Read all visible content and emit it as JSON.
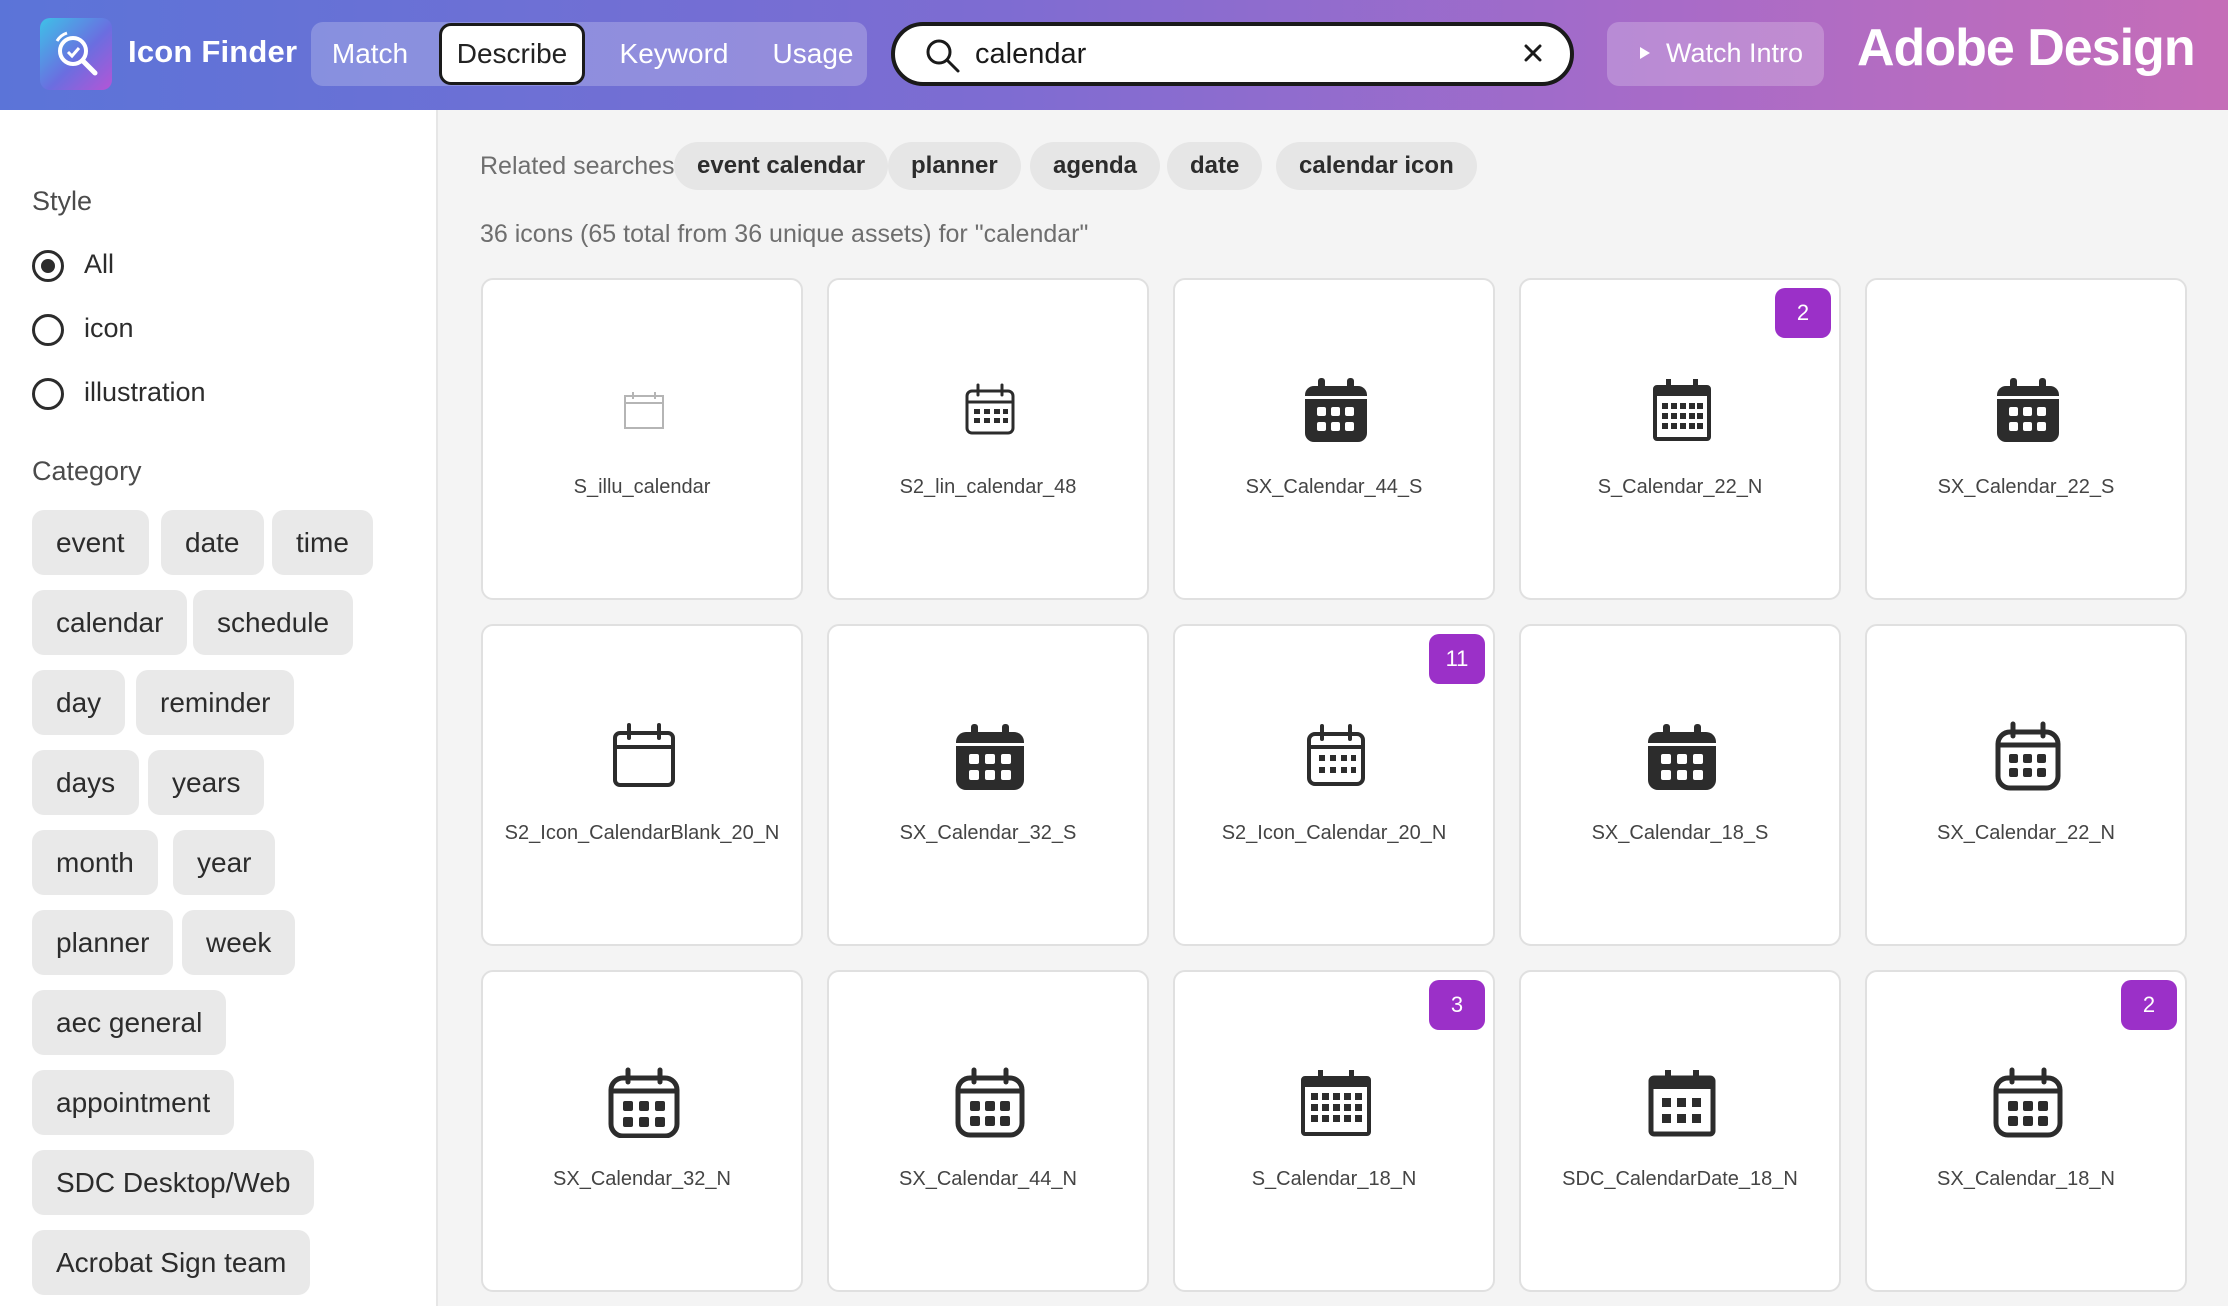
{
  "header": {
    "app_title": "Icon Finder",
    "tabs": [
      {
        "label": "Match",
        "active": false
      },
      {
        "label": "Describe",
        "active": true
      },
      {
        "label": "Keyword",
        "active": false
      },
      {
        "label": "Usage",
        "active": false
      }
    ],
    "search": {
      "value": "calendar",
      "placeholder": ""
    },
    "watch_intro": "Watch Intro",
    "brand": "Adobe Design"
  },
  "sidebar": {
    "style_heading": "Style",
    "style_options": [
      {
        "label": "All",
        "checked": true
      },
      {
        "label": "icon",
        "checked": false
      },
      {
        "label": "illustration",
        "checked": false
      }
    ],
    "category_heading": "Category",
    "categories": [
      "event",
      "date",
      "time",
      "calendar",
      "schedule",
      "day",
      "reminder",
      "days",
      "years",
      "month",
      "year",
      "planner",
      "week",
      "aec general",
      "appointment",
      "SDC Desktop/Web",
      "Acrobat Sign team"
    ]
  },
  "main": {
    "related_label": "Related searches",
    "related": [
      "event calendar",
      "planner",
      "agenda",
      "date",
      "calendar icon"
    ],
    "result_count": "36 icons (65 total from 36 unique assets) for \"calendar\"",
    "results": [
      {
        "name": "S_illu_calendar",
        "icon": "illustration-calendar-icon",
        "badge": ""
      },
      {
        "name": "S2_lin_calendar_48",
        "icon": "calendar-outline-icon",
        "badge": ""
      },
      {
        "name": "SX_Calendar_44_S",
        "icon": "calendar-solid-icon",
        "badge": ""
      },
      {
        "name": "S_Calendar_22_N",
        "icon": "calendar-grid-icon",
        "badge": "2"
      },
      {
        "name": "SX_Calendar_22_S",
        "icon": "calendar-solid-icon",
        "badge": ""
      },
      {
        "name": "S2_Icon_CalendarBlank_20_N",
        "icon": "calendar-blank-icon",
        "badge": ""
      },
      {
        "name": "SX_Calendar_32_S",
        "icon": "calendar-solid-icon",
        "badge": ""
      },
      {
        "name": "S2_Icon_Calendar_20_N",
        "icon": "calendar-outline-icon",
        "badge": "11"
      },
      {
        "name": "SX_Calendar_18_S",
        "icon": "calendar-solid-icon",
        "badge": ""
      },
      {
        "name": "SX_Calendar_22_N",
        "icon": "calendar-rounded-icon",
        "badge": ""
      },
      {
        "name": "SX_Calendar_32_N",
        "icon": "calendar-rounded-icon",
        "badge": ""
      },
      {
        "name": "SX_Calendar_44_N",
        "icon": "calendar-rounded-icon",
        "badge": ""
      },
      {
        "name": "S_Calendar_18_N",
        "icon": "calendar-grid-icon",
        "badge": "3"
      },
      {
        "name": "SDC_CalendarDate_18_N",
        "icon": "calendar-date-icon",
        "badge": ""
      },
      {
        "name": "SX_Calendar_18_N",
        "icon": "calendar-rounded-icon",
        "badge": "2"
      }
    ]
  },
  "colors": {
    "accent": "#9b30c8",
    "header_start": "#5b74d8",
    "header_end": "#c56db8"
  }
}
